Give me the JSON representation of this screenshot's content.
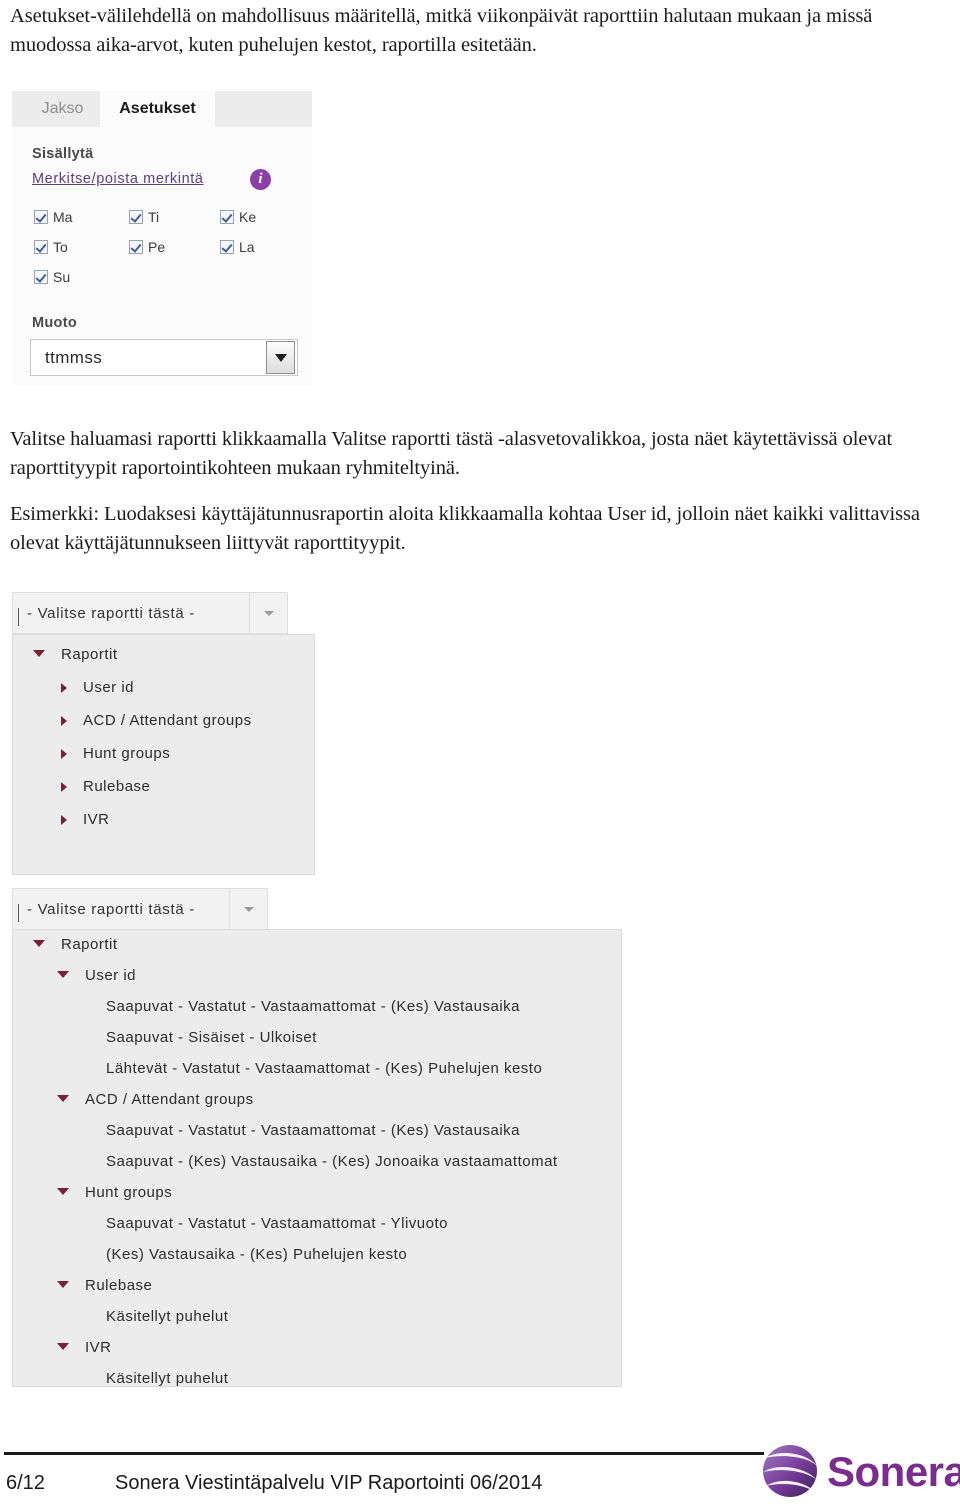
{
  "document": {
    "intro_paragraph": "Asetukset-välilehdellä on mahdollisuus määritellä, mitkä viikonpäivät raporttiin halutaan mukaan ja missä muodossa aika-arvot, kuten puhelujen kestot, raportilla esitetään.",
    "paragraph_valitse": "Valitse haluamasi raportti klikkaamalla Valitse raportti tästä -alasvetovalikkoa, josta näet käytettävissä olevat raporttityypit raportointikohteen mukaan ryhmiteltyinä.",
    "paragraph_esimerkki": "Esimerkki: Luodaksesi käyttäjätunnusraportin aloita klikkaamalla kohtaa User id, jolloin näet kaikki valittavissa olevat käyttäjätunnukseen liittyvät raporttityypit."
  },
  "settings_panel": {
    "tabs": [
      {
        "label": "Jakso",
        "active": false
      },
      {
        "label": "Asetukset",
        "active": true
      }
    ],
    "include_label": "Sisällytä",
    "toggle_link": "Merkitse/poista merkintä",
    "info_icon_glyph": "i",
    "weekdays": [
      {
        "label": "Ma",
        "checked": true
      },
      {
        "label": "Ti",
        "checked": true
      },
      {
        "label": "Ke",
        "checked": true
      },
      {
        "label": "To",
        "checked": true
      },
      {
        "label": "Pe",
        "checked": true
      },
      {
        "label": "La",
        "checked": true
      },
      {
        "label": "Su",
        "checked": true
      }
    ],
    "format_label": "Muoto",
    "format_value": "ttmmss"
  },
  "report_picker_collapsed": {
    "combo_value": "- Valitse raportti tästä -",
    "tree": [
      {
        "label": "Raportit",
        "state": "expanded",
        "depth": 0
      },
      {
        "label": "User id",
        "state": "collapsed",
        "depth": 1
      },
      {
        "label": "ACD / Attendant groups",
        "state": "collapsed",
        "depth": 1
      },
      {
        "label": "Hunt groups",
        "state": "collapsed",
        "depth": 1
      },
      {
        "label": "Rulebase",
        "state": "collapsed",
        "depth": 1
      },
      {
        "label": "IVR",
        "state": "collapsed",
        "depth": 1
      }
    ]
  },
  "report_picker_expanded": {
    "combo_value": "- Valitse raportti tästä -",
    "tree": [
      {
        "label": "Raportit",
        "state": "expanded",
        "depth": 0
      },
      {
        "label": "User id",
        "state": "expanded",
        "depth": 1
      },
      {
        "label": "Saapuvat - Vastatut - Vastaamattomat - (Kes) Vastausaika",
        "state": "leaf",
        "depth": 2
      },
      {
        "label": "Saapuvat - Sisäiset - Ulkoiset",
        "state": "leaf",
        "depth": 2
      },
      {
        "label": "Lähtevät - Vastatut - Vastaamattomat - (Kes) Puhelujen kesto",
        "state": "leaf",
        "depth": 2
      },
      {
        "label": "ACD / Attendant groups",
        "state": "expanded",
        "depth": 1
      },
      {
        "label": "Saapuvat - Vastatut - Vastaamattomat - (Kes) Vastausaika",
        "state": "leaf",
        "depth": 2
      },
      {
        "label": "Saapuvat - (Kes) Vastausaika - (Kes) Jonoaika vastaamattomat",
        "state": "leaf",
        "depth": 2
      },
      {
        "label": "Hunt groups",
        "state": "expanded",
        "depth": 1
      },
      {
        "label": "Saapuvat - Vastatut - Vastaamattomat - Ylivuoto",
        "state": "leaf",
        "depth": 2
      },
      {
        "label": "(Kes) Vastausaika - (Kes) Puhelujen kesto",
        "state": "leaf",
        "depth": 2
      },
      {
        "label": "Rulebase",
        "state": "expanded",
        "depth": 1
      },
      {
        "label": "Käsitellyt puhelut",
        "state": "leaf",
        "depth": 2
      },
      {
        "label": "IVR",
        "state": "expanded",
        "depth": 1
      },
      {
        "label": "Käsitellyt puhelut",
        "state": "leaf",
        "depth": 2
      }
    ]
  },
  "footer": {
    "page_number": "6/12",
    "title": "Sonera Viestintäpalvelu VIP Raportointi 06/2014",
    "brand": "Sonera",
    "brand_color": "#7b2d8e"
  }
}
